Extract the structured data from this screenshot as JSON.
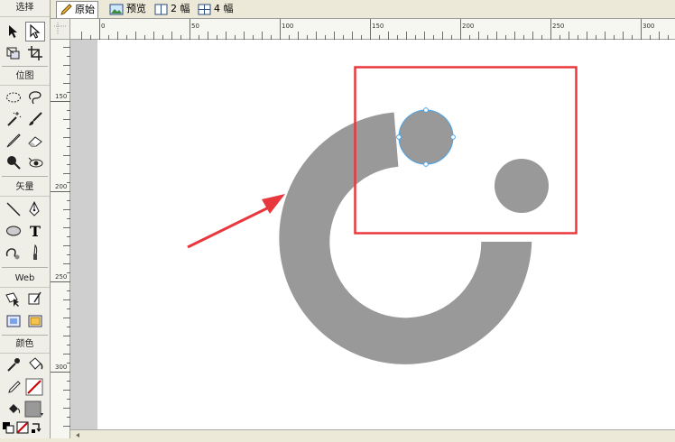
{
  "tools_panel": {
    "headers": {
      "select": "选择",
      "bitmap": "位图",
      "vector": "矢量",
      "web": "Web",
      "colors": "颜色"
    },
    "text_tool_glyph": "T",
    "icons": [
      "pointer-arrow-icon",
      "subselect-arrow-icon",
      "scale-icon",
      "crop-icon",
      "marquee-icon",
      "lasso-icon",
      "magic-wand-icon",
      "brush-icon",
      "pencil-icon",
      "eraser-icon",
      "blur-icon",
      "red-eye-icon",
      "line-icon",
      "pen-icon",
      "ellipse-icon",
      "text-icon",
      "freeform-icon",
      "knife-icon",
      "hotspot-icon",
      "slice-icon",
      "hide-slices-icon",
      "show-slices-icon",
      "eyedropper-icon",
      "paint-bucket-icon",
      "stroke-color-icon",
      "fill-color-icon",
      "default-colors-icon",
      "no-stroke-icon",
      "swap-colors-icon"
    ],
    "colors": {
      "stroke_swatch": "#ffffff",
      "fill_swatch": "#999999",
      "no_stroke_slash": "#d00000"
    }
  },
  "doc_tabs": [
    {
      "label": "原始",
      "icon": "pencil-icon",
      "active": true
    },
    {
      "label": "预览",
      "icon": "preview-icon",
      "active": false
    },
    {
      "label": "2 幅",
      "icon": "two-up-icon",
      "active": false
    },
    {
      "label": "4 幅",
      "icon": "four-up-icon",
      "active": false
    }
  ],
  "rulers": {
    "horizontal_labels": [
      "0",
      "50",
      "100",
      "150",
      "200",
      "250",
      "300"
    ],
    "vertical_labels": [
      "150",
      "200",
      "250",
      "300"
    ]
  },
  "canvas": {
    "shape_fill": "#999999",
    "selection_stroke": "#4aa3e8",
    "annotation_color": "#e8383d"
  }
}
